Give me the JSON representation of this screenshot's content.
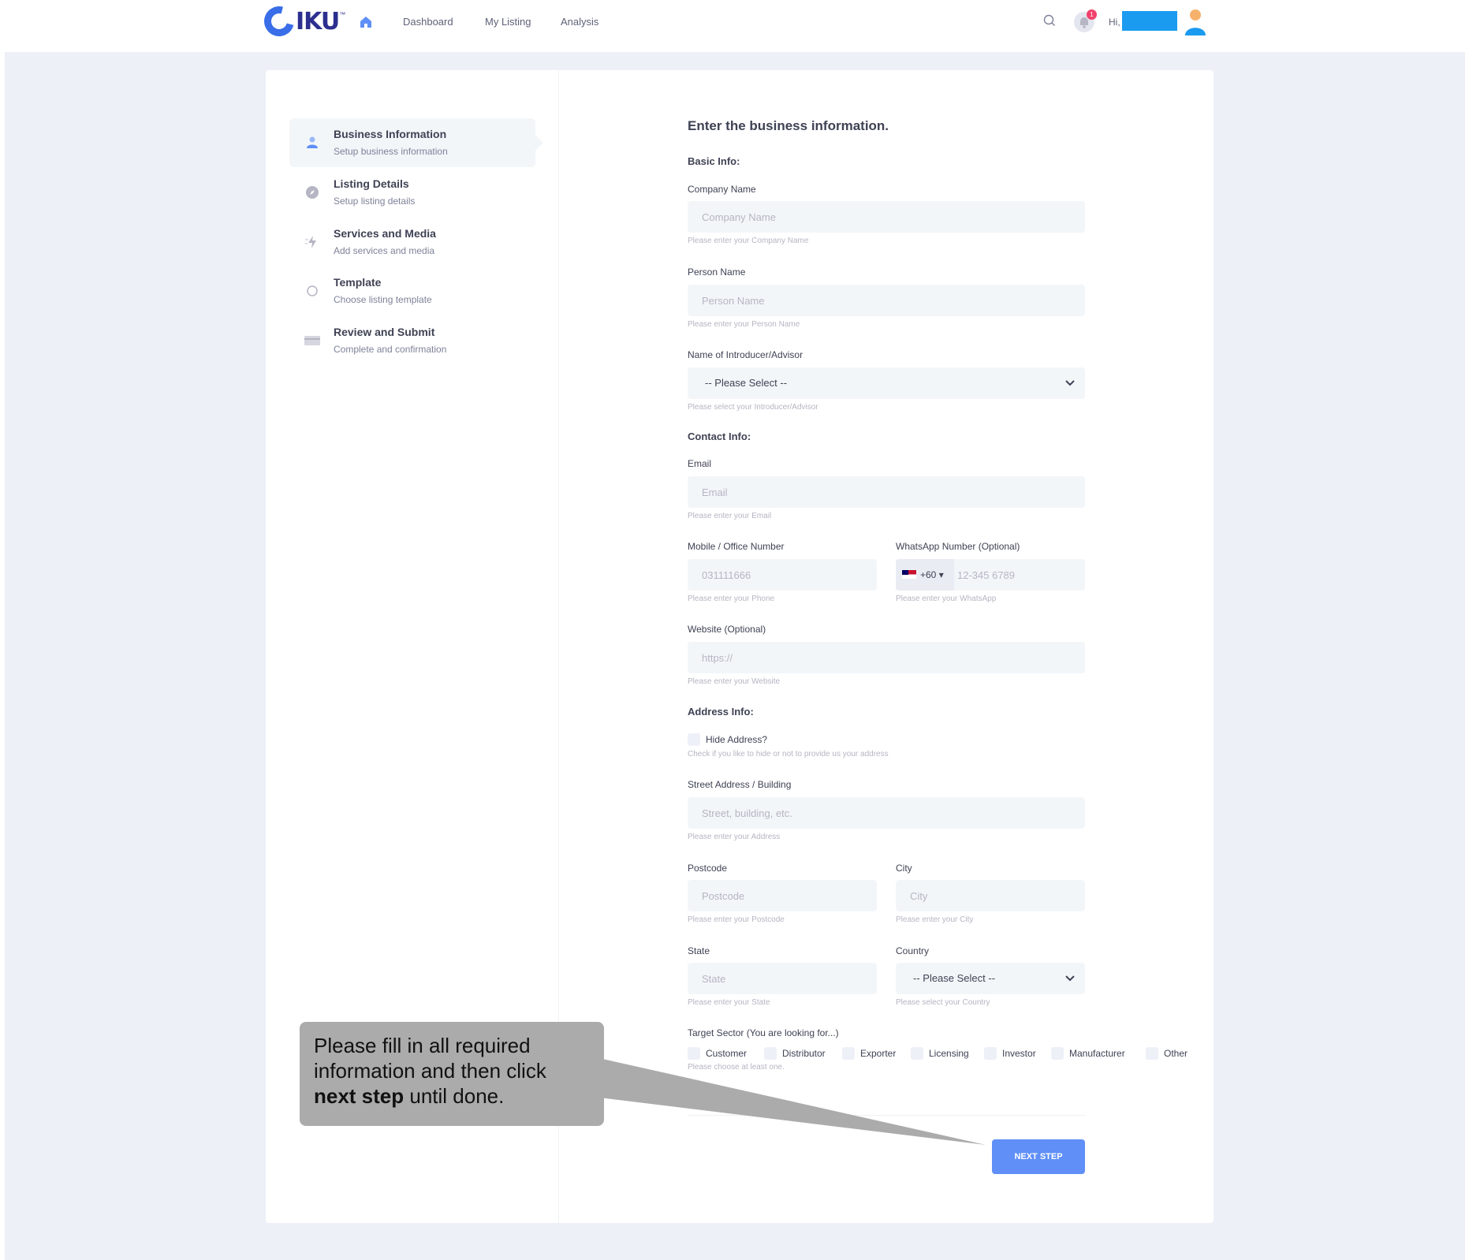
{
  "nav": {
    "logo_text": "IKU",
    "logo_tm": "™",
    "links": [
      "Dashboard",
      "My Listing",
      "Analysis"
    ],
    "notification_count": "1",
    "greeting": "Hi,"
  },
  "steps": [
    {
      "title": "Business Information",
      "subtitle": "Setup business information",
      "icon": "user-icon",
      "active": true
    },
    {
      "title": "Listing Details",
      "subtitle": "Setup listing details",
      "icon": "compass-icon",
      "active": false
    },
    {
      "title": "Services and Media",
      "subtitle": "Add services and media",
      "icon": "bolt-icon",
      "active": false
    },
    {
      "title": "Template",
      "subtitle": "Choose listing template",
      "icon": "circle-icon",
      "active": false
    },
    {
      "title": "Review and Submit",
      "subtitle": "Complete and confirmation",
      "icon": "card-icon",
      "active": false
    }
  ],
  "form": {
    "heading": "Enter the business information.",
    "basic_info": "Basic Info:",
    "company": {
      "label": "Company Name",
      "placeholder": "Company Name",
      "hint": "Please enter your Company Name"
    },
    "person": {
      "label": "Person Name",
      "placeholder": "Person Name",
      "hint": "Please enter your Person Name"
    },
    "introducer": {
      "label": "Name of Introducer/Advisor",
      "value": "-- Please Select --",
      "hint": "Please select your Introducer/Advisor"
    },
    "contact_info": "Contact Info:",
    "email": {
      "label": "Email",
      "placeholder": "Email",
      "hint": "Please enter your Email"
    },
    "mobile": {
      "label": "Mobile / Office Number",
      "placeholder": "031111666",
      "hint": "Please enter your Phone"
    },
    "whatsapp": {
      "label": "WhatsApp Number (Optional)",
      "prefix": "+60 ▾",
      "placeholder": "12-345 6789",
      "hint": "Please enter your WhatsApp"
    },
    "website": {
      "label": "Website (Optional)",
      "placeholder": "https://",
      "hint": "Please enter your Website"
    },
    "address_info": "Address Info:",
    "hide_address": {
      "label": "Hide Address?",
      "hint": "Check if you like to hide or not to provide us your address"
    },
    "street": {
      "label": "Street Address / Building",
      "placeholder": "Street, building, etc.",
      "hint": "Please enter your Address"
    },
    "postcode": {
      "label": "Postcode",
      "placeholder": "Postcode",
      "hint": "Please enter your Postcode"
    },
    "city": {
      "label": "City",
      "placeholder": "City",
      "hint": "Please enter your City"
    },
    "state": {
      "label": "State",
      "placeholder": "State",
      "hint": "Please enter your State"
    },
    "country": {
      "label": "Country",
      "value": "-- Please Select --",
      "hint": "Please select your Country"
    },
    "target": {
      "label": "Target Sector (You are looking for...)",
      "hint": "Please choose at least one.",
      "options": [
        "Customer",
        "Distributor",
        "Exporter",
        "Licensing",
        "Investor",
        "Manufacturer",
        "Other"
      ]
    },
    "next_button": "NEXT STEP"
  },
  "callout": {
    "line1": "Please fill in all required",
    "line2": "information and then click",
    "bold": "next step",
    "rest": " until done."
  },
  "colors": {
    "accent": "#5f8ff7",
    "brand": "#2c2f8f",
    "field_bg": "#f3f6f9",
    "page_bg": "#eef0f8"
  }
}
